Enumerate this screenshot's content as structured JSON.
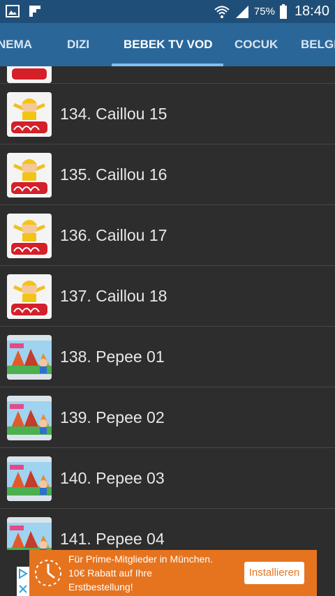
{
  "status_bar": {
    "battery": "75%",
    "time": "18:40"
  },
  "tabs": [
    {
      "label": "NEMA"
    },
    {
      "label": "DIZI"
    },
    {
      "label": "BEBEK TV VOD"
    },
    {
      "label": "COCUK"
    },
    {
      "label": "BELGE"
    }
  ],
  "list": {
    "items": [
      {
        "label": "134. Caillou 15",
        "thumb": "caillou"
      },
      {
        "label": "135. Caillou 16",
        "thumb": "caillou"
      },
      {
        "label": "136. Caillou 17",
        "thumb": "caillou"
      },
      {
        "label": "137. Caillou 18",
        "thumb": "caillou"
      },
      {
        "label": "138. Pepee 01",
        "thumb": "pepee"
      },
      {
        "label": "139. Pepee 02",
        "thumb": "pepee"
      },
      {
        "label": "140. Pepee 03",
        "thumb": "pepee"
      },
      {
        "label": "141. Pepee 04",
        "thumb": "pepee"
      }
    ]
  },
  "ad": {
    "line1": "Für Prime-Mitglieder in München.",
    "line2": "10€ Rabatt auf Ihre",
    "line3": "Erstbestellung!",
    "button": "Installieren"
  }
}
